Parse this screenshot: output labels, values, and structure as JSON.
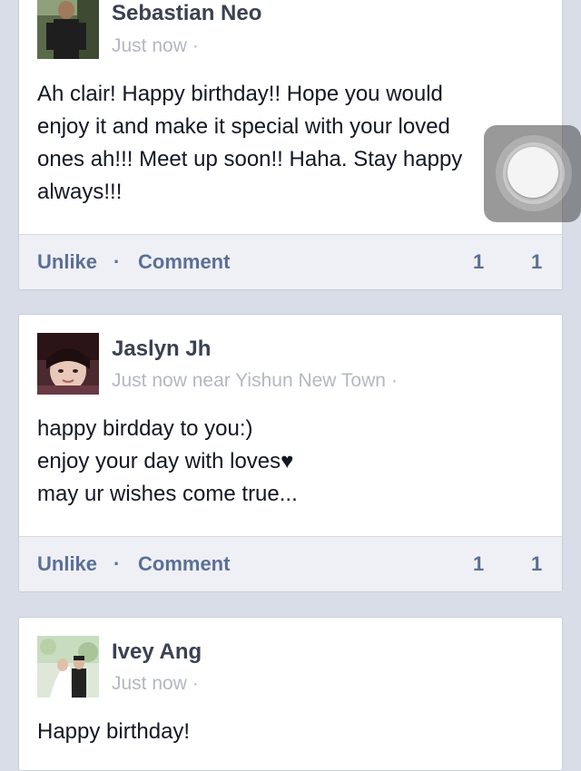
{
  "posts": [
    {
      "author": "Sebastian Neo",
      "time": "Just now",
      "location": "",
      "lines": [
        "Ah clair! Happy birthday!! Hope you would",
        "enjoy it and make it special with your loved",
        "ones ah!!! Meet up soon!! Haha. Stay happy",
        "always!!!"
      ],
      "actions": {
        "unlike": "Unlike",
        "separator": "·",
        "comment": "Comment"
      },
      "likes": "1",
      "comments": "1"
    },
    {
      "author": "Jaslyn Jh",
      "time": "Just now near Yishun New Town",
      "location": "",
      "lines": [
        "happy birdday to you:)",
        "enjoy your day with loves♥",
        "may ur wishes come true..."
      ],
      "actions": {
        "unlike": "Unlike",
        "separator": "·",
        "comment": "Comment"
      },
      "likes": "1",
      "comments": "1"
    },
    {
      "author": "Ivey Ang",
      "time": "Just now",
      "location": "",
      "lines": [
        "Happy birthday!"
      ]
    }
  ],
  "meta_dot": "·",
  "overlay": {
    "icon": "assistive-touch-icon"
  },
  "colors": {
    "background": "#d8dde7",
    "action_text": "#5b6f96",
    "author_text": "#3b4151",
    "meta_text": "#b4b8c1"
  }
}
